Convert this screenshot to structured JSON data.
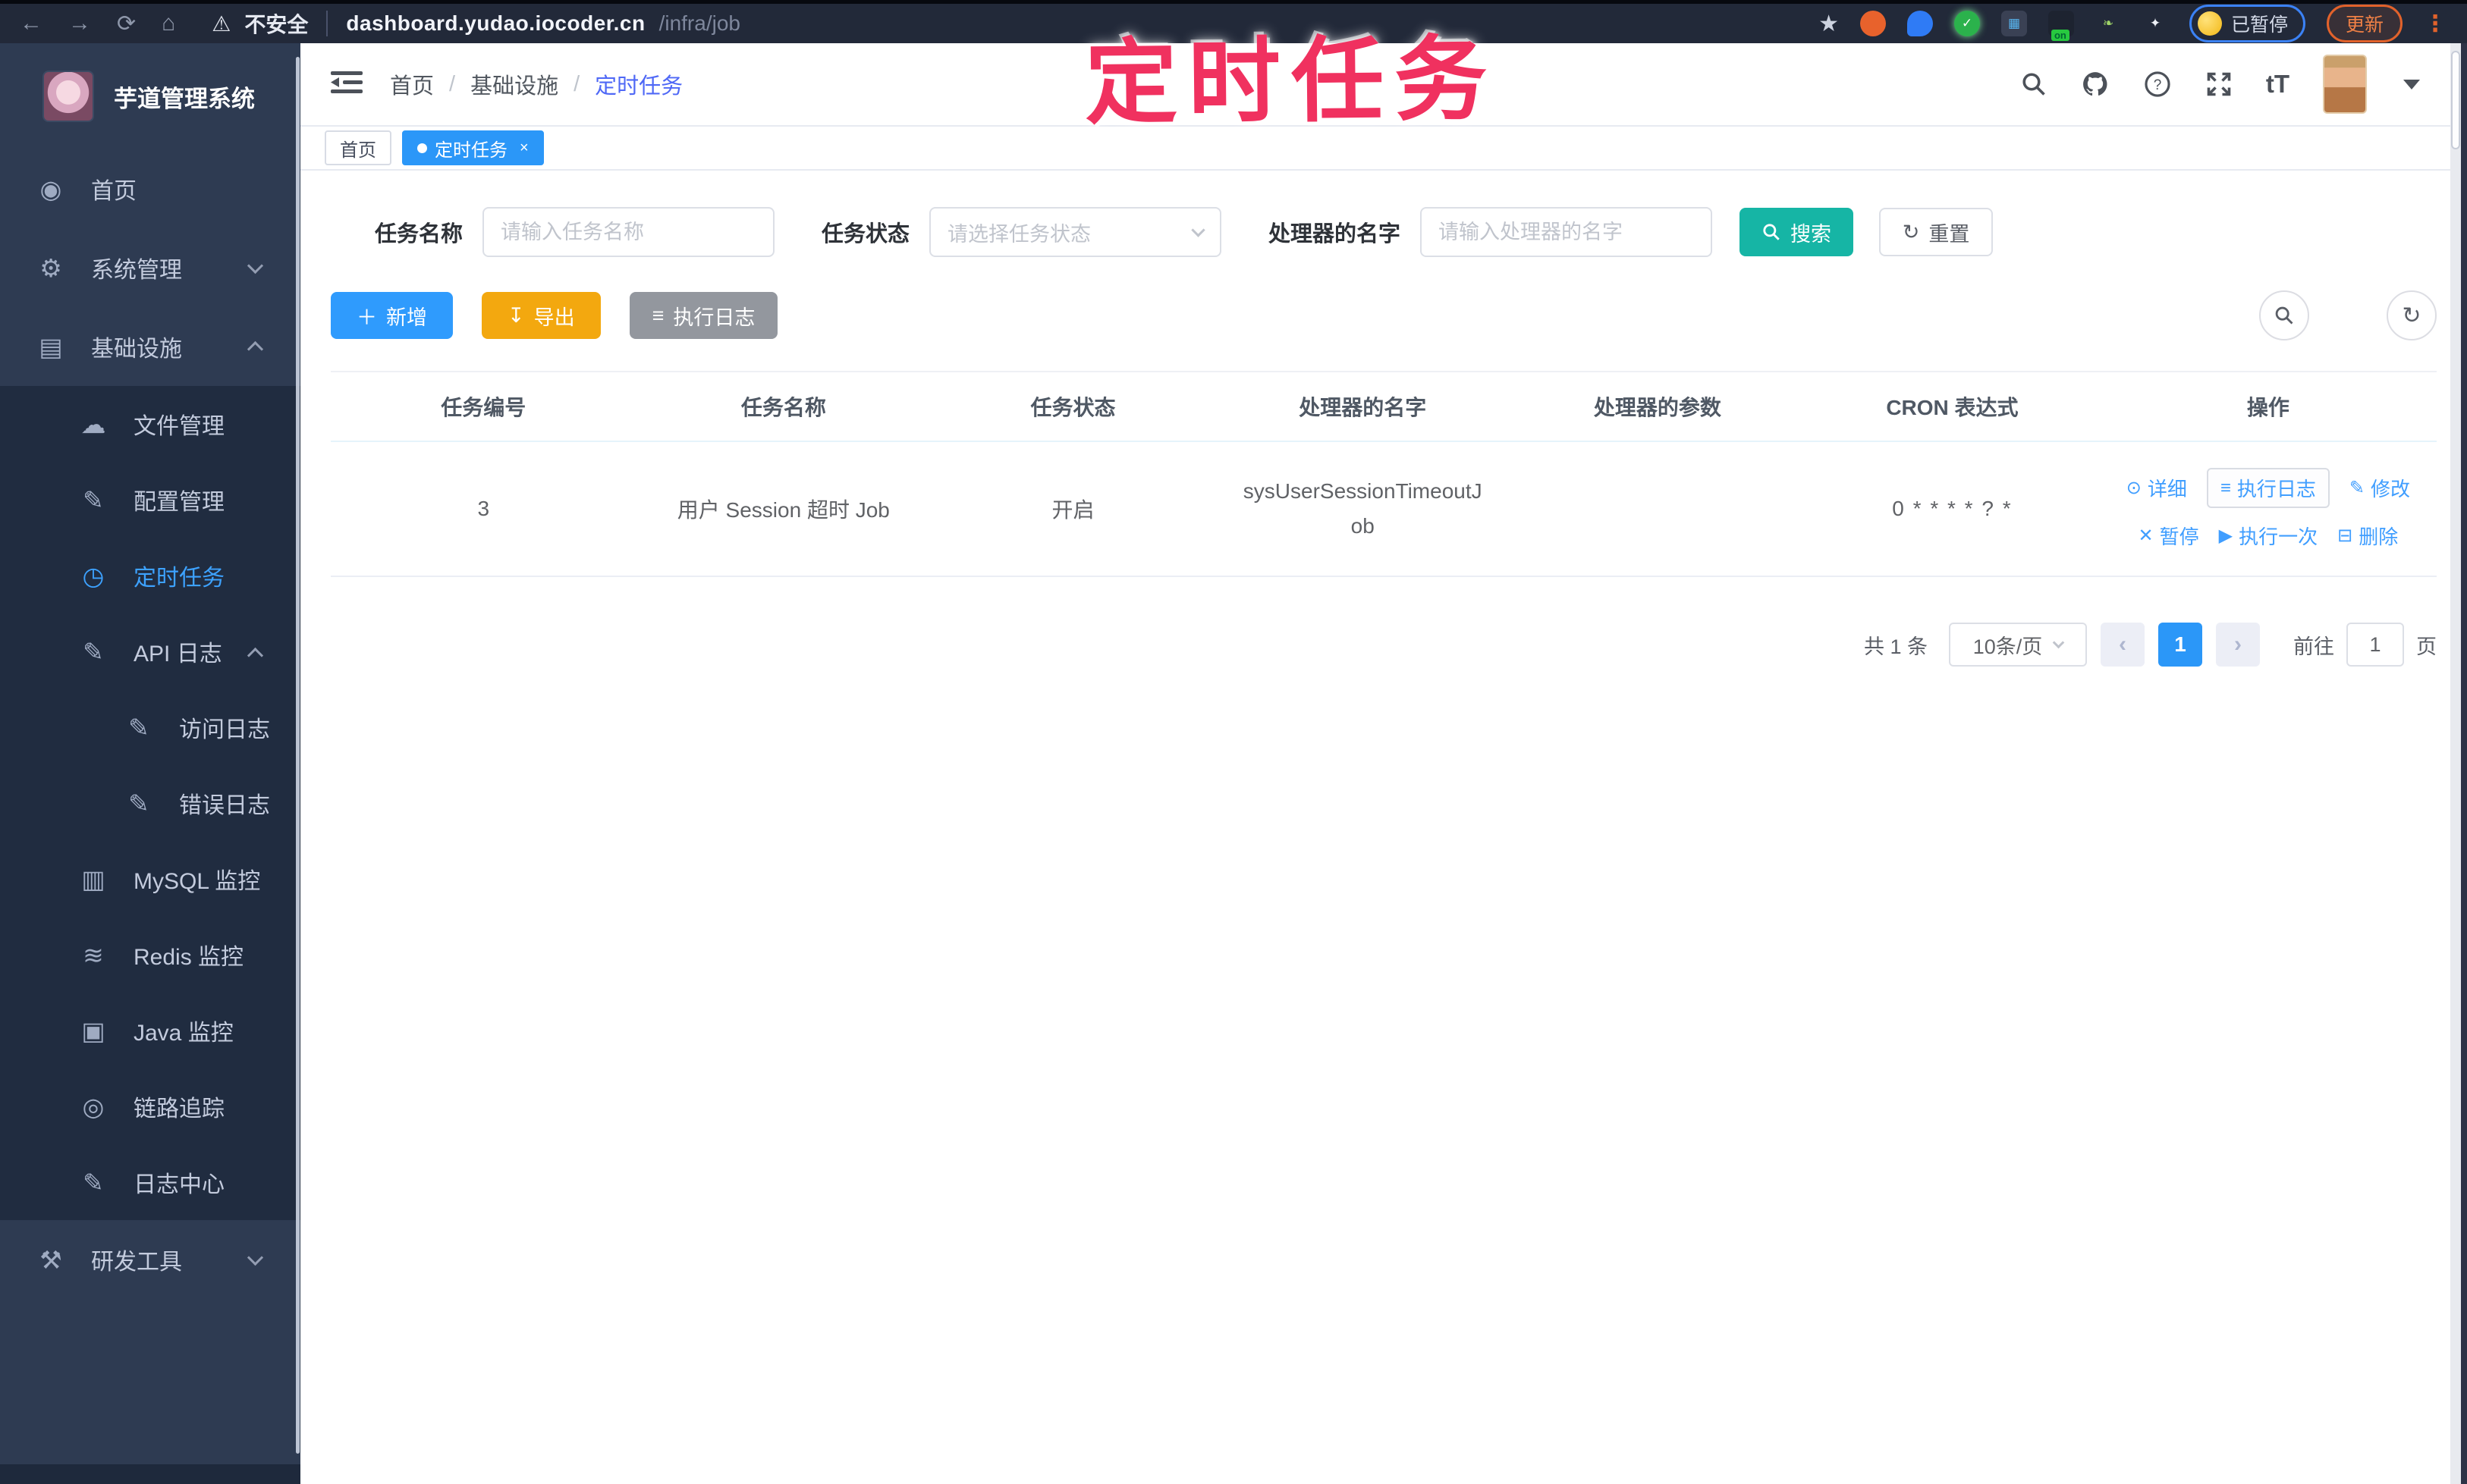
{
  "browser": {
    "security_label": "不安全",
    "url_host": "dashboard.yudao.iocoder.cn",
    "url_path": "/infra/job",
    "paused_label": "已暂停",
    "update_label": "更新",
    "on_badge": "on"
  },
  "annotation": {
    "text": "定时任务",
    "color": "#f0315f"
  },
  "sidebar": {
    "title": "芋道管理系统",
    "items": [
      {
        "label": "首页"
      },
      {
        "label": "系统管理"
      },
      {
        "label": "基础设施"
      },
      {
        "label": "文件管理"
      },
      {
        "label": "配置管理"
      },
      {
        "label": "定时任务"
      },
      {
        "label": "API 日志"
      },
      {
        "label": "访问日志"
      },
      {
        "label": "错误日志"
      },
      {
        "label": "MySQL 监控"
      },
      {
        "label": "Redis 监控"
      },
      {
        "label": "Java 监控"
      },
      {
        "label": "链路追踪"
      },
      {
        "label": "日志中心"
      },
      {
        "label": "研发工具"
      }
    ],
    "active_item": "定时任务"
  },
  "header": {
    "breadcrumb": [
      "首页",
      "基础设施",
      "定时任务"
    ]
  },
  "tags": {
    "home": "首页",
    "active": "定时任务",
    "close": "×"
  },
  "filters": {
    "name_label": "任务名称",
    "name_placeholder": "请输入任务名称",
    "status_label": "任务状态",
    "status_placeholder": "请选择任务状态",
    "handler_label": "处理器的名字",
    "handler_placeholder": "请输入处理器的名字",
    "search_label": "搜索",
    "reset_label": "重置"
  },
  "toolbar": {
    "add": "新增",
    "export": "导出",
    "exec_log": "执行日志"
  },
  "table": {
    "columns": [
      "任务编号",
      "任务名称",
      "任务状态",
      "处理器的名字",
      "处理器的参数",
      "CRON 表达式",
      "操作"
    ],
    "rows": [
      {
        "id": "3",
        "name": "用户 Session 超时 Job",
        "status": "开启",
        "handler": "sysUserSessionTimeoutJob",
        "params": "",
        "cron": "0 * * * * ? *",
        "actions": [
          "详细",
          "执行日志",
          "修改",
          "暂停",
          "执行一次",
          "删除"
        ]
      }
    ]
  },
  "pagination": {
    "total": "共 1 条",
    "page_size": "10条/页",
    "current": "1",
    "goto_label": "前往",
    "goto_value": "1",
    "page_label": "页"
  },
  "colors": {
    "accent_blue": "#409eff",
    "tag_active": "#2b97f8",
    "search_teal": "#16b5a5",
    "export_orange": "#f3a80f"
  }
}
